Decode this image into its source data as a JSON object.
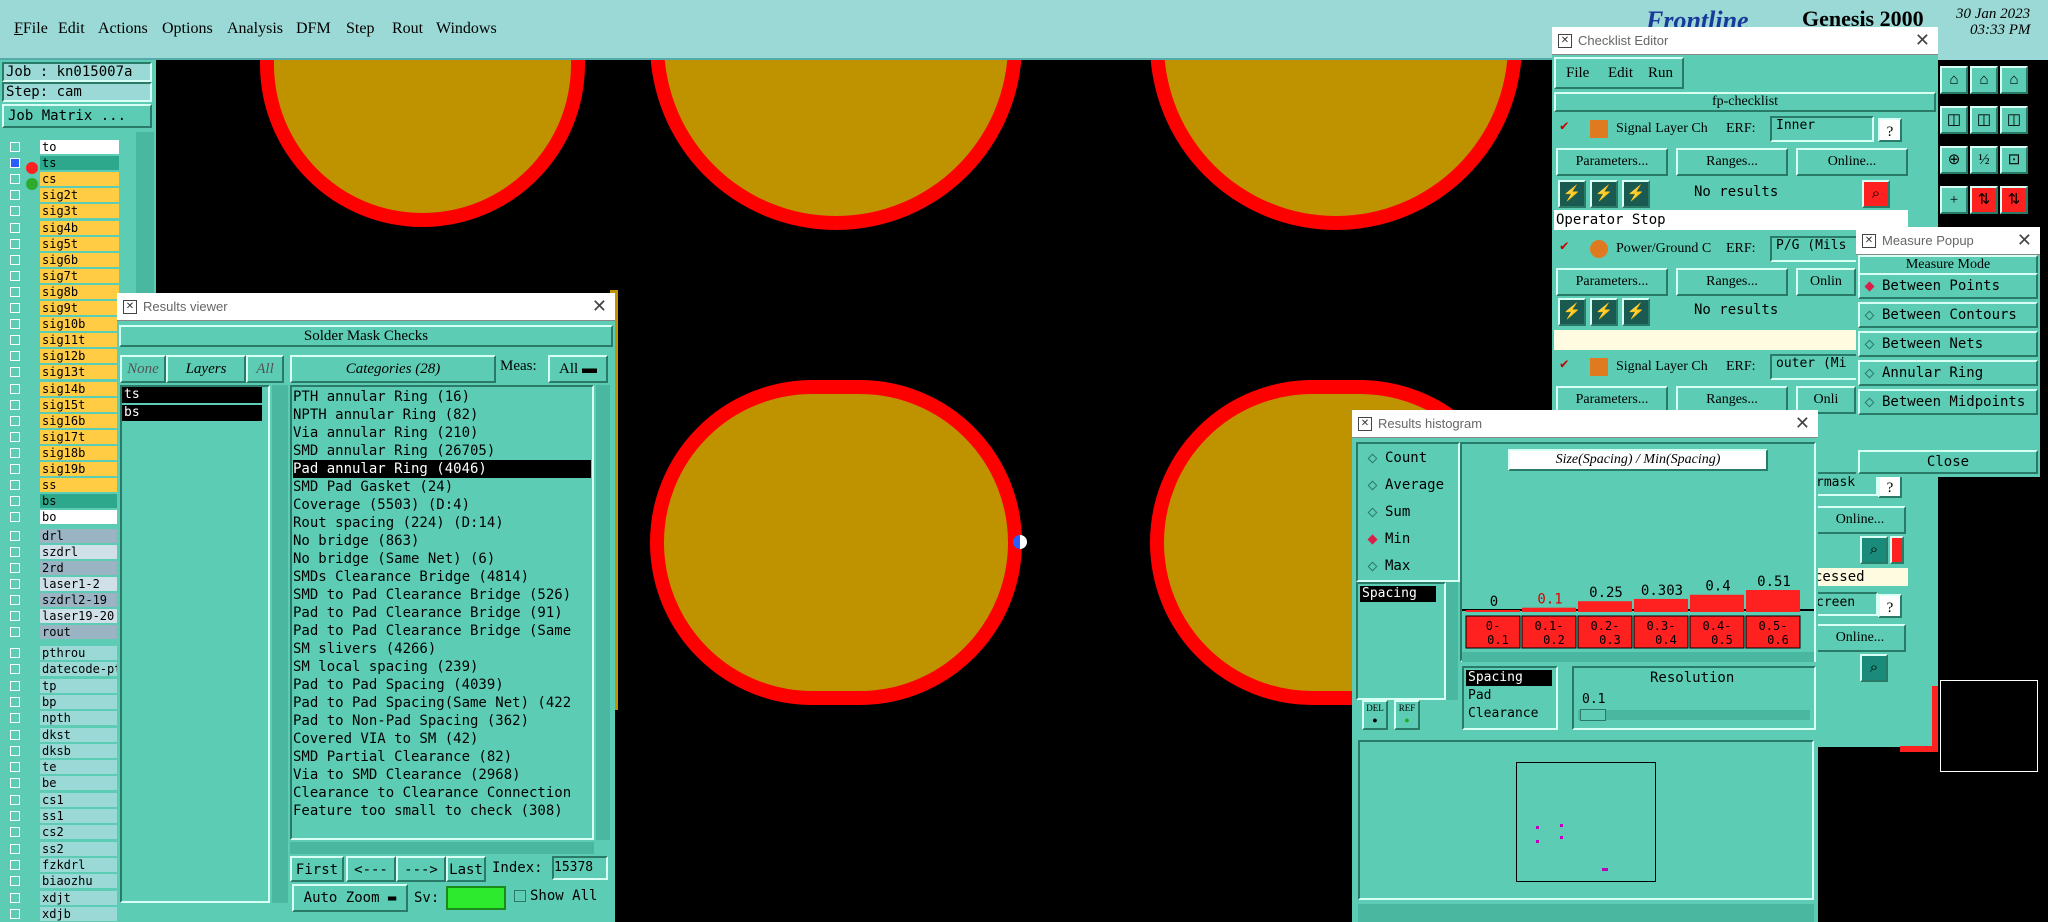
{
  "menubar": {
    "items": [
      "File",
      "Edit",
      "Actions",
      "Options",
      "Analysis",
      "DFM",
      "Step",
      "Rout",
      "Windows"
    ],
    "brand": "Frontline",
    "app_name": "Genesis 2000",
    "date": "30 Jan 2023",
    "time": "03:33 PM"
  },
  "job": {
    "job_label": "Job : kn015007a",
    "step_label": "Step: cam",
    "matrix_button": "Job Matrix ..."
  },
  "layers": [
    {
      "name": "to",
      "color": "#ffffff"
    },
    {
      "name": "ts",
      "color": "#2ea88c"
    },
    {
      "name": "cs",
      "color": "#ffcc44"
    },
    {
      "name": "sig2t",
      "color": "#ffcc44"
    },
    {
      "name": "sig3t",
      "color": "#ffcc44"
    },
    {
      "name": "sig4b",
      "color": "#ffcc44"
    },
    {
      "name": "sig5t",
      "color": "#ffcc44"
    },
    {
      "name": "sig6b",
      "color": "#ffcc44"
    },
    {
      "name": "sig7t",
      "color": "#ffcc44"
    },
    {
      "name": "sig8b",
      "color": "#ffcc44"
    },
    {
      "name": "sig9t",
      "color": "#ffcc44"
    },
    {
      "name": "sig10b",
      "color": "#ffcc44"
    },
    {
      "name": "sig11t",
      "color": "#ffcc44"
    },
    {
      "name": "sig12b",
      "color": "#ffcc44"
    },
    {
      "name": "sig13t",
      "color": "#ffcc44"
    },
    {
      "name": "sig14b",
      "color": "#ffcc44"
    },
    {
      "name": "sig15t",
      "color": "#ffcc44"
    },
    {
      "name": "sig16b",
      "color": "#ffcc44"
    },
    {
      "name": "sig17t",
      "color": "#ffcc44"
    },
    {
      "name": "sig18b",
      "color": "#ffcc44"
    },
    {
      "name": "sig19b",
      "color": "#ffcc44"
    },
    {
      "name": "ss",
      "color": "#ffcc44"
    },
    {
      "name": "bs",
      "color": "#2ea88c"
    },
    {
      "name": "bo",
      "color": "#ffffff"
    }
  ],
  "drill_layers": [
    "drl",
    "szdrl",
    "2rd",
    "laser1-2",
    "szdrl2-19",
    "laser19-20",
    "rout"
  ],
  "misc_layers": [
    "pthrou",
    "datecode-pt",
    "tp",
    "bp",
    "npth",
    "dkst",
    "dksb",
    "te",
    "be",
    "cs1",
    "ss1",
    "cs2",
    "ss2",
    "fzkdrl",
    "biaozhu",
    "xdjt",
    "xdjb"
  ],
  "results_viewer": {
    "title": "Results viewer",
    "header": "Solder Mask Checks",
    "none_btn": "None",
    "layers_btn": "Layers",
    "all_btn": "All",
    "categories_btn": "Categories (28)",
    "meas_label": "Meas:",
    "meas_value": "All",
    "layer_list": [
      "ts",
      "bs"
    ],
    "categories": [
      "PTH annular Ring (16)",
      "NPTH annular Ring (82)",
      "Via annular Ring (210)",
      "SMD annular Ring (26705)",
      "Pad annular Ring (4046)",
      "SMD Pad Gasket (24)",
      "Coverage (5503)           (D:4)",
      "Rout spacing (224)        (D:14)",
      "No bridge (863)",
      "No bridge (Same Net) (6)",
      "SMDs Clearance Bridge (4814)",
      "SMD to Pad Clearance Bridge (526)",
      "Pad to Pad Clearance Bridge (91)",
      "Pad to Pad Clearance Bridge (Same",
      "SM slivers (4266)",
      "SM local spacing (239)",
      "Pad to Pad Spacing (4039)",
      "Pad to Pad Spacing(Same Net) (422",
      "Pad to Non-Pad Spacing (362)",
      "Covered VIA to SM (42)",
      "SMD Partial Clearance (82)",
      "Via to SMD Clearance (2968)",
      "Clearance to Clearance Connection",
      "Feature too small to check (308)"
    ],
    "selected_index": 4,
    "nav": {
      "first": "First",
      "prev": "<---",
      "next": "--->",
      "last": "Last",
      "index_label": "Index:",
      "index_value": "15378"
    },
    "auto_zoom": "Auto Zoom",
    "sv_label": "Sv:",
    "show_all": "Show All"
  },
  "checklist_editor": {
    "title": "Checklist Editor",
    "menu": [
      "File",
      "Edit",
      "Run"
    ],
    "name": "fp-checklist",
    "erf_label": "ERF:",
    "rows": [
      {
        "label": "Signal Layer Ch",
        "erf": "Inner",
        "status": "No results",
        "params": "Parameters...",
        "ranges": "Ranges...",
        "online": "Online..."
      },
      {
        "label": "Power/Ground C",
        "erf": "P/G (Mils",
        "status": "No results",
        "params": "Parameters...",
        "ranges": "Ranges...",
        "online": "Onlin"
      },
      {
        "label": "Signal Layer Ch",
        "erf": "outer (Mi",
        "params": "Parameters...",
        "ranges": "Ranges...",
        "online": "Onli"
      }
    ],
    "operator_stop": "Operator Stop",
    "fragments": [
      "rmask",
      "Online...",
      "cessed",
      "creen",
      "Online..."
    ]
  },
  "measure_popup": {
    "title": "Measure Popup",
    "header": "Measure Mode",
    "modes": [
      "Between Points",
      "Between Contours",
      "Between Nets",
      "Annular Ring",
      "Between Midpoints"
    ],
    "selected": 0,
    "close": "Close"
  },
  "histogram": {
    "title": "Results histogram",
    "options": [
      "Count",
      "Average",
      "Sum",
      "Min",
      "Max"
    ],
    "selected_option": 3,
    "chart_title": "Size(Spacing) / Min(Spacing)",
    "list_item": "Spacing",
    "bottom_list": [
      "Spacing",
      "Pad",
      "Clearance"
    ],
    "resolution_label": "Resolution",
    "resolution_value": "0.1",
    "del_btn": "DEL",
    "ref_btn": "REF"
  },
  "chart_data": {
    "type": "bar",
    "title": "Size(Spacing) / Min(Spacing)",
    "categories": [
      "0-0.1",
      "0.1-0.2",
      "0.2-0.3",
      "0.3-0.4",
      "0.4-0.5",
      "0.5-0.6"
    ],
    "values": [
      0,
      0.1,
      0.25,
      0.303,
      0.4,
      0.51
    ],
    "value_labels": [
      "0",
      "0.1",
      "0.25",
      "0.303",
      "0.4",
      "0.51"
    ],
    "highlight_index": 1,
    "bar_color": "#ff2020"
  },
  "colors": {
    "pad_fill": "#bf9300",
    "pad_outline": "#ff0000",
    "panel": "#5ccdb4",
    "menubar": "#9ad9d6"
  }
}
